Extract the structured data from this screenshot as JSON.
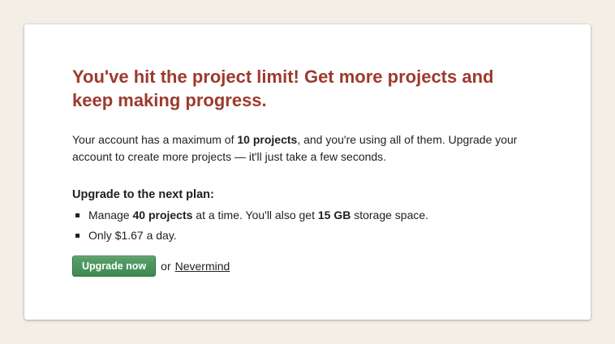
{
  "modal": {
    "title": "You've hit the project limit! Get more projects and keep making progress.",
    "intro": {
      "part1": "Your account has a maximum of ",
      "limit": "10 projects",
      "part2": ", and you're using all of them. Upgrade your account to create more projects — it'll just take a few seconds."
    },
    "plan_heading": "Upgrade to the next plan:",
    "benefits": [
      {
        "part1": "Manage ",
        "projects": "40 projects",
        "part2": " at a time. You'll also get ",
        "storage": "15 GB",
        "part3": " storage space."
      },
      {
        "text": "Only $1.67 a day."
      }
    ],
    "actions": {
      "upgrade_label": "Upgrade now",
      "or_text": "or",
      "nevermind_label": "Nevermind"
    }
  }
}
